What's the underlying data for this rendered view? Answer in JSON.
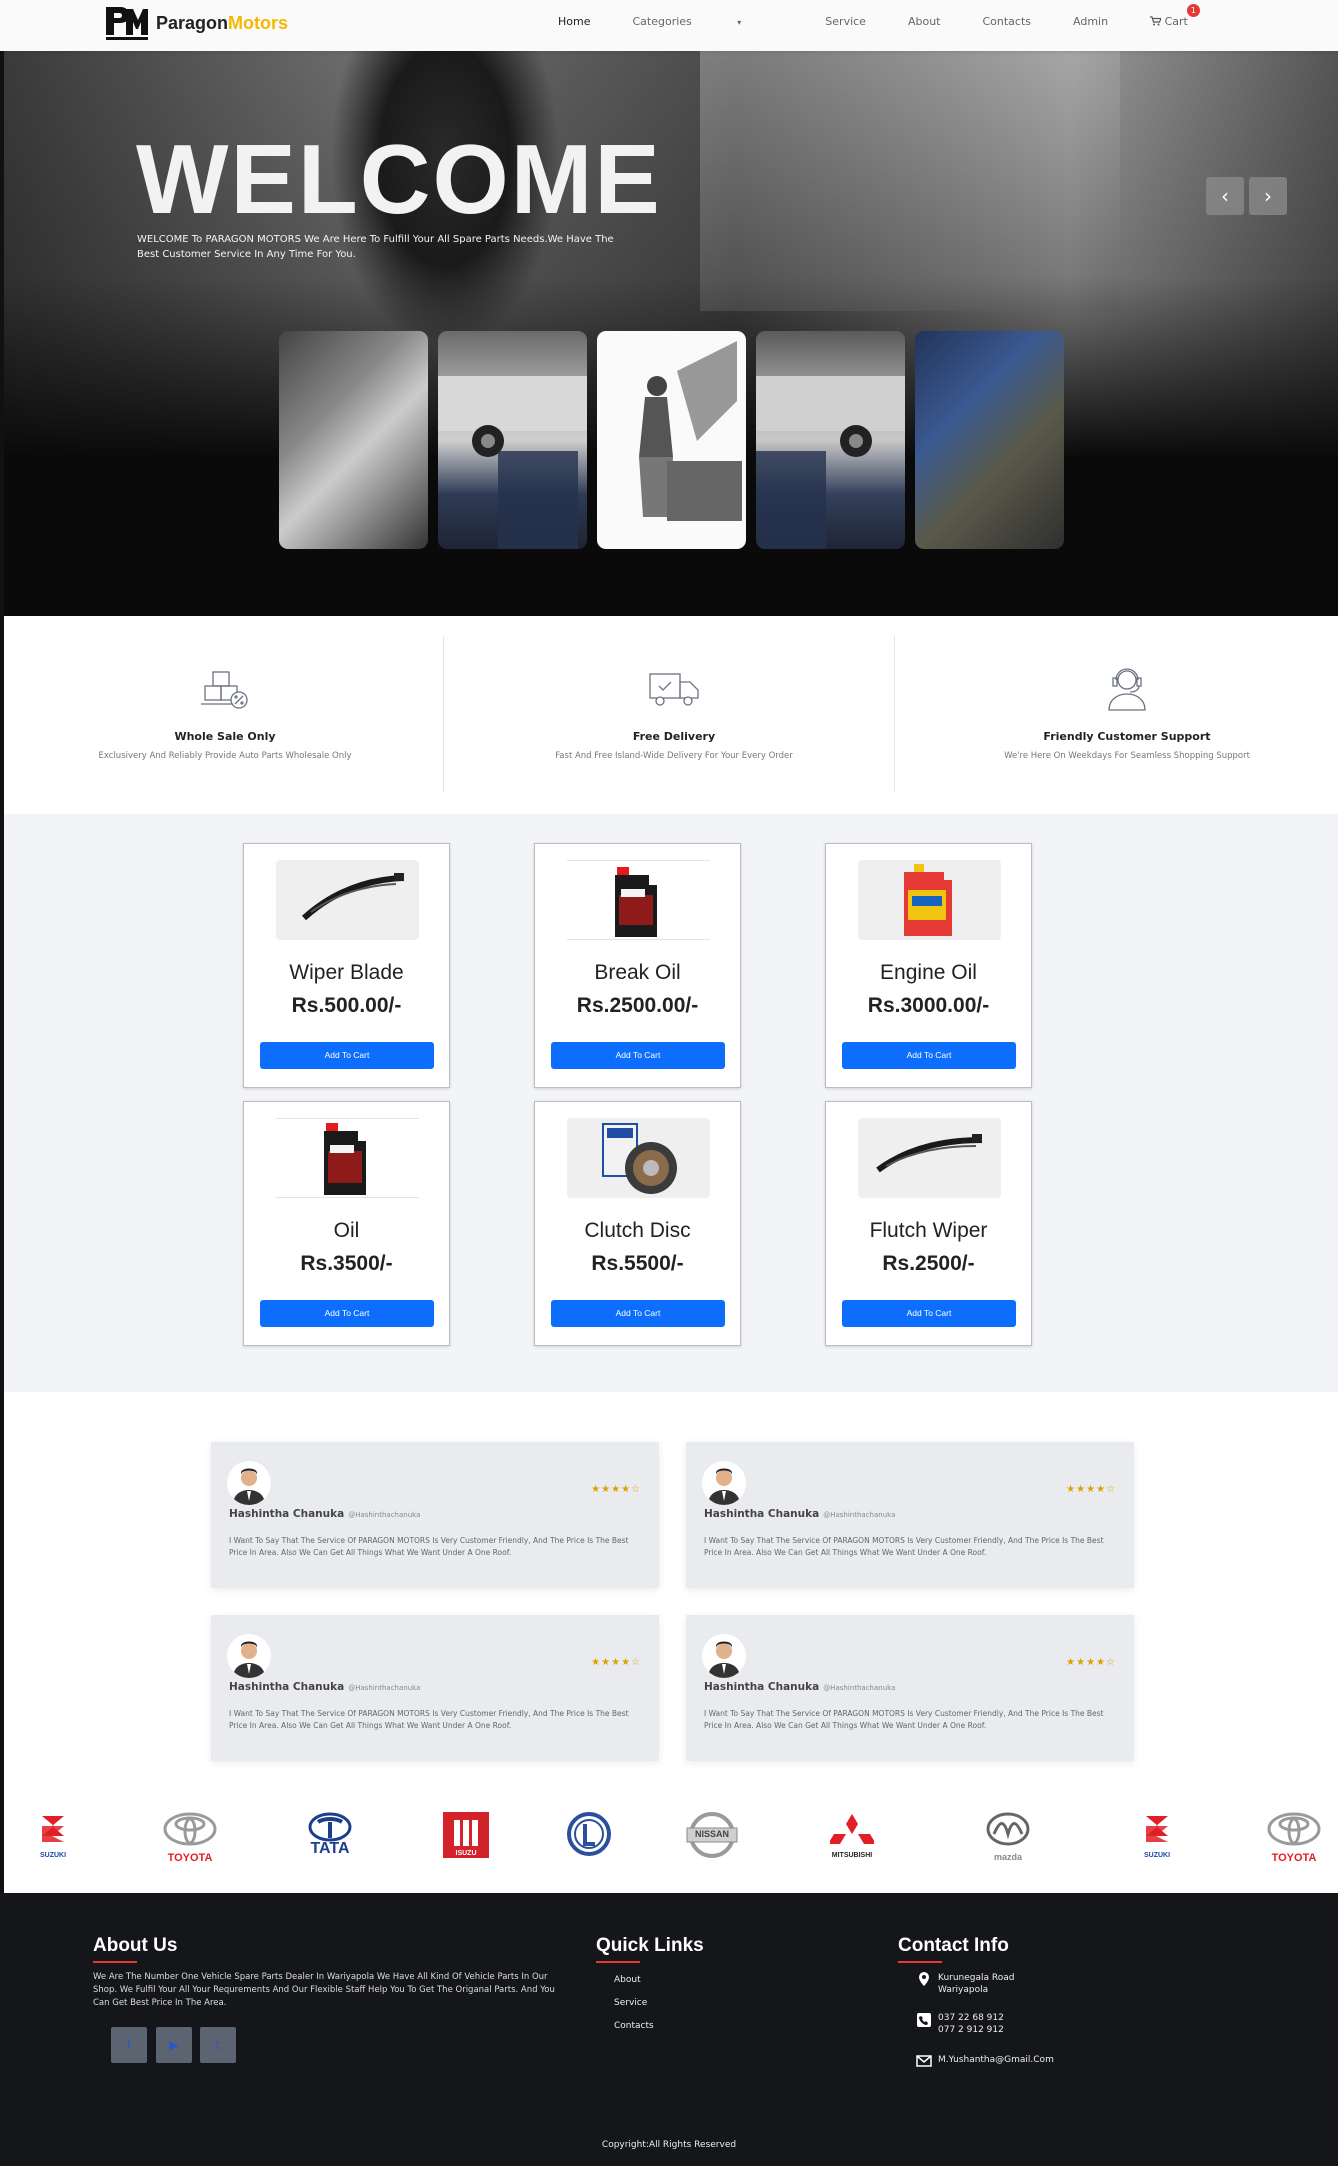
{
  "brand": {
    "name_part1": "Paragon",
    "name_part2": "Motors"
  },
  "nav": {
    "items": [
      "Home",
      "Categories",
      "Service",
      "About",
      "Contacts",
      "Admin"
    ],
    "cart_label": "Cart",
    "cart_count": "1"
  },
  "hero": {
    "title": "WELCOME",
    "subtitle": "WELCOME To PARAGON MOTORS We Are Here To Fulfill Your All Spare Parts Needs.We Have The Best Customer Service In Any Time For You."
  },
  "features": [
    {
      "title": "Whole Sale Only",
      "desc": "Exclusivery And Reliably Provide Auto Parts Wholesale Only"
    },
    {
      "title": "Free Delivery",
      "desc": "Fast And Free Island-Wide Delivery For Your Every Order"
    },
    {
      "title": "Friendly Customer Support",
      "desc": "We're Here On Weekdays For Seamless Shopping Support"
    }
  ],
  "products": [
    {
      "name": "Wiper Blade",
      "price": "Rs.500.00/-",
      "button": "Add To Cart"
    },
    {
      "name": "Break Oil",
      "price": "Rs.2500.00/-",
      "button": "Add To Cart"
    },
    {
      "name": "Engine Oil",
      "price": "Rs.3000.00/-",
      "button": "Add To Cart"
    },
    {
      "name": "Oil",
      "price": "Rs.3500/-",
      "button": "Add To Cart"
    },
    {
      "name": "Clutch Disc",
      "price": "Rs.5500/-",
      "button": "Add To Cart"
    },
    {
      "name": "Flutch Wiper",
      "price": "Rs.2500/-",
      "button": "Add To Cart"
    }
  ],
  "reviews": [
    {
      "name": "Hashintha Chanuka",
      "handle": "@Hashinthachanuka",
      "stars": "★★★★☆",
      "text": "I Want To Say That The Service Of PARAGON MOTORS Is Very Customer Friendly, And The Price Is The Best Price In Area. Also We Can Get All Things What We Want Under A One Roof."
    },
    {
      "name": "Hashintha Chanuka",
      "handle": "@Hashinthachanuka",
      "stars": "★★★★☆",
      "text": "I Want To Say That The Service Of PARAGON MOTORS Is Very Customer Friendly, And The Price Is The Best Price In Area. Also We Can Get All Things What We Want Under A One Roof."
    },
    {
      "name": "Hashintha Chanuka",
      "handle": "@Hashinthachanuka",
      "stars": "★★★★☆",
      "text": "I Want To Say That The Service Of PARAGON MOTORS Is Very Customer Friendly, And The Price Is The Best Price In Area. Also We Can Get All Things What We Want Under A One Roof."
    },
    {
      "name": "Hashintha Chanuka",
      "handle": "@Hashinthachanuka",
      "stars": "★★★★☆",
      "text": "I Want To Say That The Service Of PARAGON MOTORS Is Very Customer Friendly, And The Price Is The Best Price In Area. Also We Can Get All Things What We Want Under A One Roof."
    }
  ],
  "brands": [
    "SUZUKI",
    "TOYOTA",
    "TATA",
    "ISUZU",
    "",
    "NISSAN",
    "MITSUBISHI",
    "mazda",
    "SUZUKI",
    "TOYOTA"
  ],
  "footer": {
    "about_title": "About Us",
    "about_text": "We Are The Number One Vehicle Spare Parts Dealer In Wariyapola We Have All Kind Of Vehicle Parts In Our Shop. We Fulfil Your All Your Requrements And Our Flexible Staff Help You To Get The Origanal Parts. And You Can Get Best Price In The Area.",
    "links_title": "Quick Links",
    "links": [
      "About",
      "Service",
      "Contacts"
    ],
    "contact_title": "Contact Info",
    "address_line1": "Kurunegala Road",
    "address_line2": "Wariyapola",
    "phone1": "037 22 68 912",
    "phone2": "077 2 912 912",
    "email": "M.Yushantha@Gmail.Com",
    "copyright": "Copyright:All Rights Reserved"
  },
  "colors": {
    "primary_button": "#0d6efd",
    "brand_accent": "#f5b800",
    "footer_bg": "#15161a",
    "footer_underline": "#e53935",
    "stars": "#d9a400"
  }
}
